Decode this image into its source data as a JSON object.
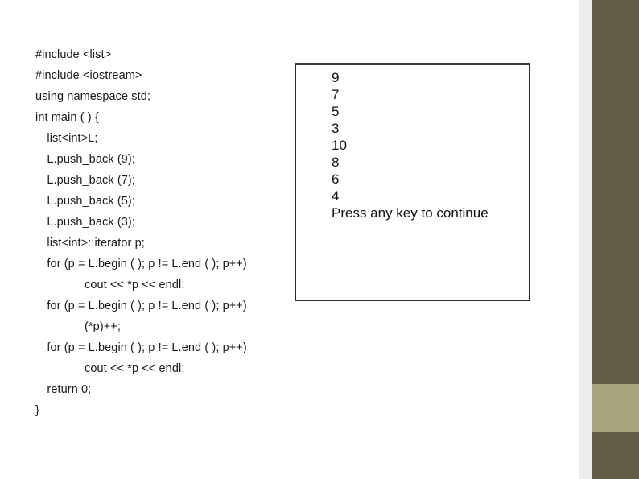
{
  "slide": {
    "background_color": "#FFFFFF",
    "accent_dark": "#635C46",
    "accent_light": "#A7A67F",
    "gutter_color": "#EDEDED"
  },
  "code": {
    "language": "C++",
    "lines": [
      {
        "indent": 0,
        "text": "#include <list>"
      },
      {
        "indent": 0,
        "text": "#include <iostream>"
      },
      {
        "indent": 0,
        "text": "using namespace std;"
      },
      {
        "indent": 0,
        "text": "int main ( ) {"
      },
      {
        "indent": 1,
        "pre": "   list<int>L;",
        "text": "   list<int>L;"
      },
      {
        "indent": 1,
        "text": "   L.push_back (9);"
      },
      {
        "indent": 1,
        "text": "   L.push_back (7);"
      },
      {
        "indent": 1,
        "text": "   L.push_back (5);"
      },
      {
        "indent": 1,
        "text": "   L.push_back (3);"
      },
      {
        "indent": 1,
        "text": "   list<int>::iterator p;"
      },
      {
        "indent": 1,
        "text": "   for (p = L.begin ( ); p != L.end ( ); p++)"
      },
      {
        "indent": 3,
        "text": "cout << *p << endl;"
      },
      {
        "indent": 1,
        "text": "   for (p = L.begin ( ); p != L.end ( ); p++)"
      },
      {
        "indent": 3,
        "text": "(*p)++;"
      },
      {
        "indent": 1,
        "text": "   for (p = L.begin ( ); p != L.end ( ); p++)"
      },
      {
        "indent": 3,
        "text": "cout << *p << endl;"
      },
      {
        "indent": 1,
        "text": "   return 0;"
      },
      {
        "indent": 0,
        "text": "}"
      }
    ]
  },
  "console": {
    "title": "program-output",
    "lines": [
      "9",
      "7",
      "5",
      "3",
      "10",
      "8",
      "6",
      "4",
      "Press any key to continue"
    ]
  }
}
